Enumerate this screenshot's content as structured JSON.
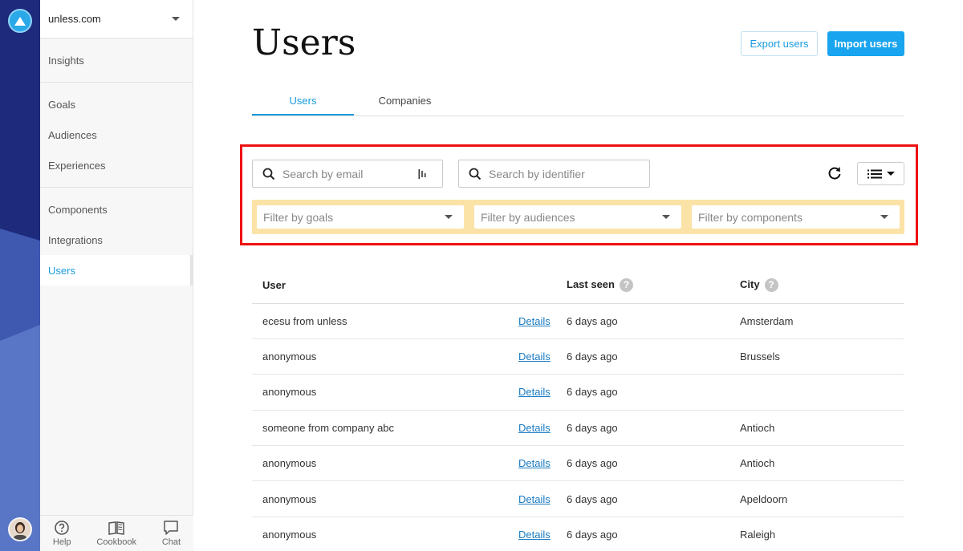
{
  "app": {
    "logo_icon": "unless-logo-icon",
    "rail_color": "#1e2a7c",
    "accent": "#18a4ee"
  },
  "sidebar": {
    "site": "unless.com",
    "groups": [
      [
        {
          "label": "Insights"
        }
      ],
      [
        {
          "label": "Goals"
        },
        {
          "label": "Audiences"
        },
        {
          "label": "Experiences"
        }
      ],
      [
        {
          "label": "Components"
        },
        {
          "label": "Integrations"
        },
        {
          "label": "Users",
          "active": true
        }
      ]
    ],
    "footer": [
      {
        "label": "Help",
        "icon": "help-circle-icon"
      },
      {
        "label": "Cookbook",
        "icon": "book-icon"
      },
      {
        "label": "Chat",
        "icon": "chat-bubble-icon"
      }
    ]
  },
  "header": {
    "title": "Users",
    "export_label": "Export users",
    "import_label": "Import users"
  },
  "tabs": [
    {
      "label": "Users",
      "active": true
    },
    {
      "label": "Companies",
      "active": false
    }
  ],
  "search": {
    "email_placeholder": "Search by email",
    "identifier_placeholder": "Search by identifier"
  },
  "filters": {
    "goals_placeholder": "Filter by goals",
    "audiences_placeholder": "Filter by audiences",
    "components_placeholder": "Filter by components",
    "bar_color": "#fbe3a8"
  },
  "table": {
    "headers": {
      "user": "User",
      "last_seen": "Last seen",
      "city": "City",
      "help_glyph": "?"
    },
    "details_label": "Details",
    "rows": [
      {
        "user": "ecesu from unless",
        "last_seen": "6 days ago",
        "city": "Amsterdam"
      },
      {
        "user": "anonymous",
        "last_seen": "6 days ago",
        "city": "Brussels"
      },
      {
        "user": "anonymous",
        "last_seen": "6 days ago",
        "city": ""
      },
      {
        "user": "someone from company abc",
        "last_seen": "6 days ago",
        "city": "Antioch"
      },
      {
        "user": "anonymous",
        "last_seen": "6 days ago",
        "city": "Antioch"
      },
      {
        "user": "anonymous",
        "last_seen": "6 days ago",
        "city": "Apeldoorn"
      },
      {
        "user": "anonymous",
        "last_seen": "6 days ago",
        "city": "Raleigh"
      }
    ]
  },
  "highlight_color": "#ee1111"
}
